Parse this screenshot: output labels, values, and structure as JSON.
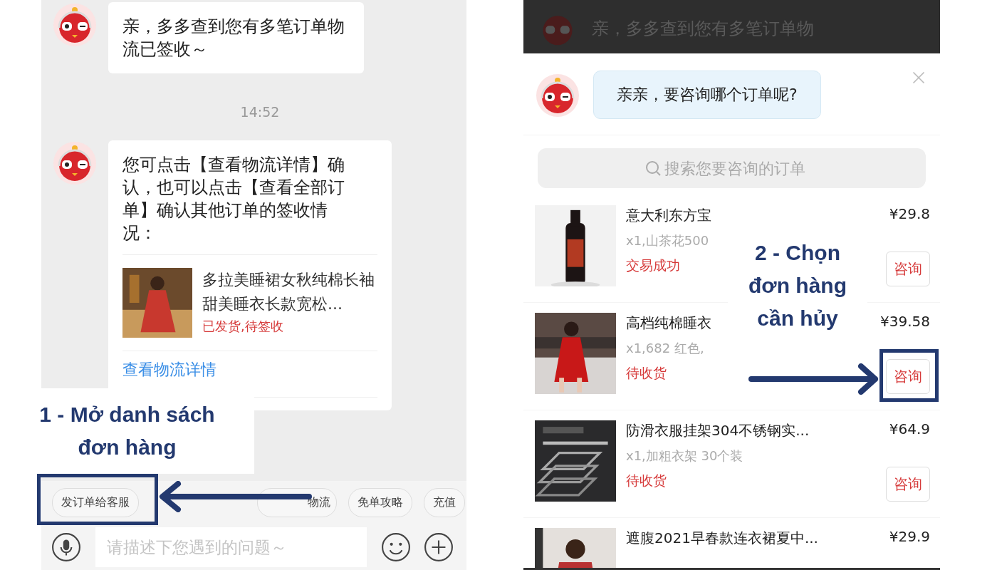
{
  "left_screen": {
    "messages": [
      {
        "text": "亲，多多查到您有多笔订单物流已签收～"
      },
      {
        "text": "您可点击【查看物流详情】确认，也可以点击【查看全部订单】确认其他订单的签收情况：",
        "order": {
          "title": "多拉美睡裙女秋纯棉长袖甜美睡衣长款宽松...",
          "status": "已发货,待签收"
        },
        "link": "查看物流详情"
      }
    ],
    "time": "14:52",
    "quick_replies": [
      {
        "label": "发订单给客服"
      },
      {
        "label": "物流"
      },
      {
        "label": "免单攻略"
      },
      {
        "label": "充值"
      }
    ],
    "input": {
      "placeholder": "请描述下您遇到的问题～"
    }
  },
  "right_screen": {
    "dimmed_message": "亲，多多查到您有多笔订单物",
    "prompt": "亲亲，要咨询哪个订单呢?",
    "search": {
      "placeholder": "搜索您要咨询的订单"
    },
    "orders": [
      {
        "title": "意大利东方宝",
        "detail": "x1,山茶花500",
        "status": "交易成功",
        "price": "¥29.8",
        "button": "咨询"
      },
      {
        "title": "高档纯棉睡衣",
        "detail": "x1,682 红色,",
        "status": "待收货",
        "price": "¥39.58",
        "button": "咨询"
      },
      {
        "title": "防滑衣服挂架304不锈钢实...",
        "detail": "x1,加粗衣架 30个装",
        "status": "待收货",
        "price": "¥64.9",
        "button": "咨询"
      },
      {
        "title": "遮腹2021早春款连衣裙夏中...",
        "price": "¥29.9"
      }
    ]
  },
  "annotations": [
    {
      "text": "1 - Mở danh sách đơn hàng"
    },
    {
      "text": "2 - Chọn đơn hàng cần hủy"
    }
  ]
}
